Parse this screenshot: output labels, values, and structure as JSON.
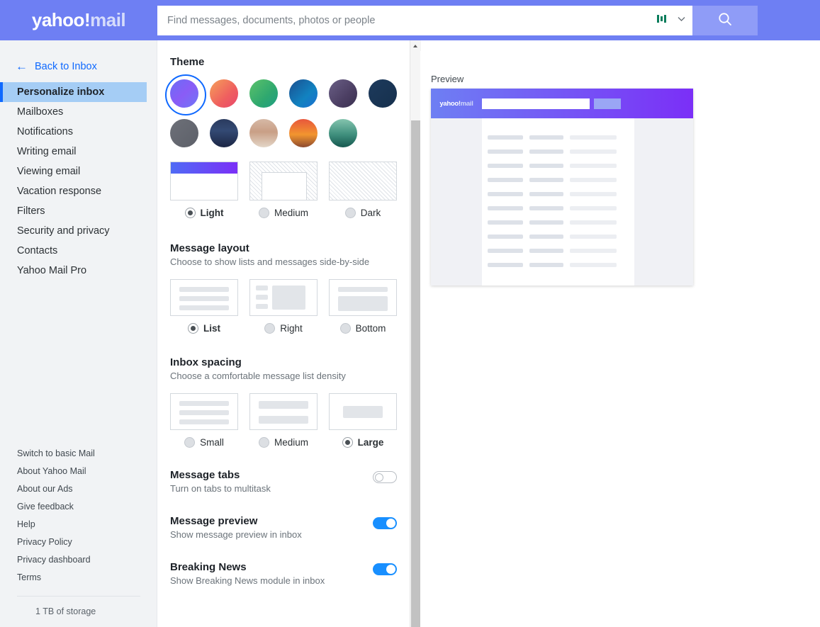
{
  "header": {
    "logo_yahoo": "yahoo",
    "logo_excl": "!",
    "logo_mail": "mail",
    "search_placeholder": "Find messages, documents, photos or people",
    "search_value": "",
    "filter_icon": "bars-icon",
    "chevron_icon": "chevron-down-icon",
    "search_icon": "search-icon",
    "bg_color": "#6e7ff3"
  },
  "sidebar": {
    "back_label": "Back to Inbox",
    "back_icon": "arrow-left-icon",
    "items": [
      {
        "label": "Personalize inbox",
        "active": true
      },
      {
        "label": "Mailboxes",
        "active": false
      },
      {
        "label": "Notifications",
        "active": false
      },
      {
        "label": "Writing email",
        "active": false
      },
      {
        "label": "Viewing email",
        "active": false
      },
      {
        "label": "Vacation response",
        "active": false
      },
      {
        "label": "Filters",
        "active": false
      },
      {
        "label": "Security and privacy",
        "active": false
      },
      {
        "label": "Contacts",
        "active": false
      },
      {
        "label": "Yahoo Mail Pro",
        "active": false
      }
    ],
    "footer_links": [
      "Switch to basic Mail",
      "About Yahoo Mail",
      "About our Ads",
      "Give feedback",
      "Help",
      "Privacy Policy",
      "Privacy dashboard",
      "Terms"
    ],
    "storage": "1 TB of storage",
    "active_color": "#a5cdf5",
    "link_color": "#0f69ff"
  },
  "settings": {
    "theme": {
      "title": "Theme",
      "swatches_row1": [
        {
          "name": "purple-gradient",
          "selected": true,
          "css": "linear-gradient(135deg,#6a6df5 0%,#8a5cf6 50%,#6f76f7 100%)"
        },
        {
          "name": "sunset-red",
          "selected": false,
          "css": "linear-gradient(135deg,#f5a05a 0%,#ef5f5f 60%,#e8486c 100%)"
        },
        {
          "name": "green",
          "selected": false,
          "css": "linear-gradient(135deg,#5cc26a 0%,#2fa86f 60%,#1f9e83 100%)"
        },
        {
          "name": "blue",
          "selected": false,
          "css": "linear-gradient(135deg,#1b4f8f 0%,#1282c0 60%,#1b6fd1 100%)"
        },
        {
          "name": "dark-violet",
          "selected": false,
          "css": "linear-gradient(135deg,#6a5f86 0%,#4c3f63 60%,#3a3050 100%)"
        },
        {
          "name": "navy",
          "selected": false,
          "css": "linear-gradient(135deg,#1d3a5c 0%,#16304d 100%)"
        }
      ],
      "swatches_row2": [
        {
          "name": "slate-gray",
          "selected": false,
          "css": "linear-gradient(135deg,#6d7078 0%,#5d6069 100%)"
        },
        {
          "name": "night-mountains",
          "selected": false,
          "css": "linear-gradient(180deg,#2a3a5e 0%,#344a74 40%,#1c2644 100%)"
        },
        {
          "name": "desert-dunes",
          "selected": false,
          "css": "linear-gradient(180deg,#d6b9a6 0%,#c99f86 45%,#e3d6c8 100%)"
        },
        {
          "name": "canyon-sunset",
          "selected": false,
          "css": "linear-gradient(180deg,#e8573c 0%,#f2952f 55%,#8c4a2f 100%)"
        },
        {
          "name": "green-valley",
          "selected": false,
          "css": "linear-gradient(180deg,#84c4ae 0%,#3f8f7d 55%,#16584f 100%)"
        }
      ],
      "modes": [
        {
          "label": "Light",
          "selected": true
        },
        {
          "label": "Medium",
          "selected": false
        },
        {
          "label": "Dark",
          "selected": false
        }
      ]
    },
    "message_layout": {
      "title": "Message layout",
      "subtitle": "Choose to show lists and messages side-by-side",
      "options": [
        {
          "label": "List",
          "selected": true
        },
        {
          "label": "Right",
          "selected": false
        },
        {
          "label": "Bottom",
          "selected": false
        }
      ]
    },
    "inbox_spacing": {
      "title": "Inbox spacing",
      "subtitle": "Choose a comfortable message list density",
      "options": [
        {
          "label": "Small",
          "selected": false
        },
        {
          "label": "Medium",
          "selected": false
        },
        {
          "label": "Large",
          "selected": true
        }
      ]
    },
    "toggles": [
      {
        "title": "Message tabs",
        "subtitle": "Turn on tabs to multitask",
        "on": false
      },
      {
        "title": "Message preview",
        "subtitle": "Show message preview in inbox",
        "on": true
      },
      {
        "title": "Breaking News",
        "subtitle": "Show Breaking News module in inbox",
        "on": true
      }
    ],
    "toggle_on_color": "#188fff"
  },
  "preview": {
    "label": "Preview",
    "logo_yahoo": "yahoo",
    "logo_excl": "!",
    "logo_mail": "mail",
    "gradient_start": "#6e7ff3",
    "gradient_end": "#7b2ff7"
  }
}
